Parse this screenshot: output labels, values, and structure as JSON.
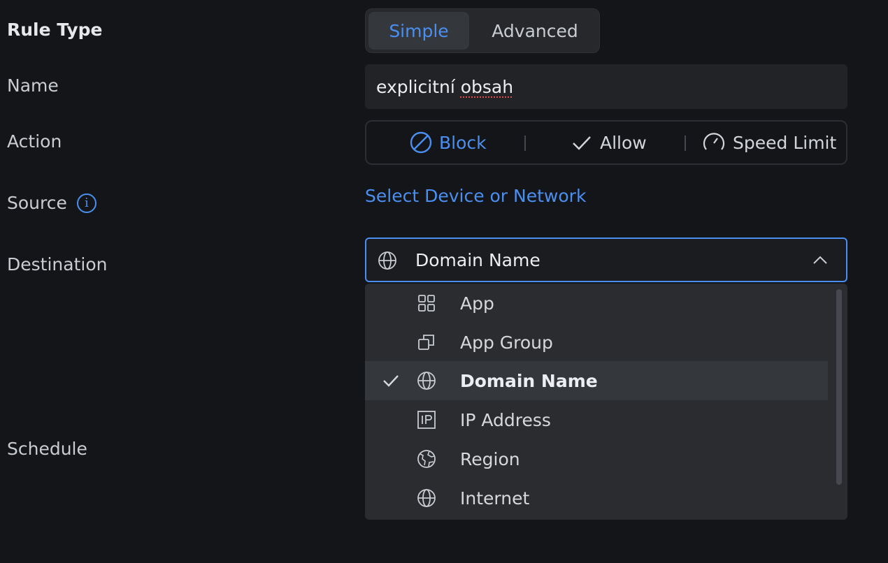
{
  "labels": {
    "rule_type": "Rule Type",
    "name": "Name",
    "action": "Action",
    "source": "Source",
    "destination": "Destination",
    "schedule": "Schedule"
  },
  "rule_type": {
    "options": [
      "Simple",
      "Advanced"
    ],
    "selected": "Simple"
  },
  "name_field": {
    "value_plain": "explicitní ",
    "value_misspelled": "obsah",
    "value": "explicitní obsah"
  },
  "action": {
    "options": [
      {
        "label": "Block",
        "icon": "block-icon"
      },
      {
        "label": "Allow",
        "icon": "check-icon"
      },
      {
        "label": "Speed Limit",
        "icon": "speedometer-icon"
      }
    ],
    "selected": "Block"
  },
  "source": {
    "link_text": "Select Device or Network",
    "icon": "info-icon"
  },
  "destination": {
    "selected": "Domain Name",
    "options": [
      {
        "label": "App",
        "icon": "grid-icon"
      },
      {
        "label": "App Group",
        "icon": "stack-icon"
      },
      {
        "label": "Domain Name",
        "icon": "globe-icon"
      },
      {
        "label": "IP Address",
        "icon": "ip-icon"
      },
      {
        "label": "Region",
        "icon": "earth-icon"
      },
      {
        "label": "Internet",
        "icon": "globe-icon"
      }
    ]
  },
  "colors": {
    "accent": "#4a8ff0",
    "background": "#141518"
  }
}
